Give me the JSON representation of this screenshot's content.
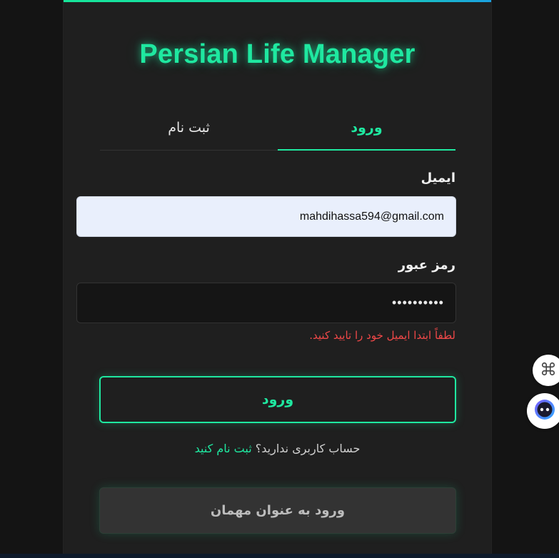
{
  "app": {
    "title": "Persian Life Manager"
  },
  "tabs": [
    {
      "label": "ورود",
      "active": true
    },
    {
      "label": "ثبت نام",
      "active": false
    }
  ],
  "form": {
    "email_label": "ایمیل",
    "email_value": "mahdihassa594@gmail.com",
    "password_label": "رمز عبور",
    "password_value": "••••••••••",
    "error_text": "لطفاً ابتدا ایمیل خود را تایید کنید.",
    "login_button": "ورود",
    "signup_prompt": "حساب کاربری ندارید؟",
    "signup_link": "ثبت نام کنید",
    "guest_button": "ورود به عنوان مهمان"
  },
  "floating": {
    "icon_1": "command-icon",
    "icon_2": "assistant-icon"
  },
  "colors": {
    "accent": "#1fe8a0",
    "error": "#f04848",
    "card_bg": "#1f1f1f",
    "page_bg": "#141414"
  }
}
